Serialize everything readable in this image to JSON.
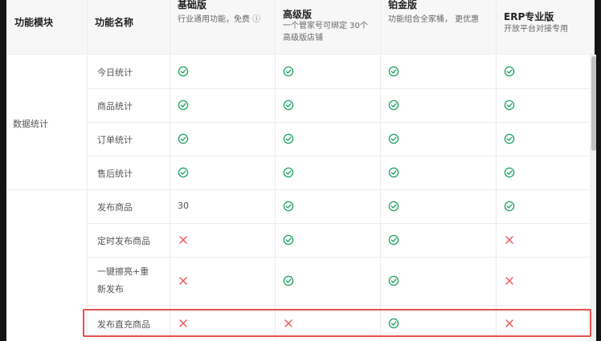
{
  "table": {
    "headers": {
      "module": "功能模块",
      "name": "功能名称",
      "basic": {
        "title": "基础版",
        "desc": [
          "行业通用功能，免费 ⓘ"
        ]
      },
      "advanced": {
        "title": "高级版",
        "desc": [
          "一个管家号可绑定 30个",
          "高级版店铺"
        ]
      },
      "platinum": {
        "title": "铂金版",
        "desc": [
          "功能组合全家桶， 更优惠"
        ]
      },
      "erp": {
        "title": "ERP专业版",
        "desc": [
          "开放平台对接专用"
        ]
      }
    },
    "groups": [
      {
        "label": "数据统计"
      },
      {
        "label": ""
      }
    ],
    "rows": [
      {
        "feature": [
          "今日统计"
        ],
        "basic": "check",
        "advanced": "check",
        "platinum": "check",
        "erp": "check"
      },
      {
        "feature": [
          "商品统计"
        ],
        "basic": "check",
        "advanced": "check",
        "platinum": "check",
        "erp": "check"
      },
      {
        "feature": [
          "订单统计"
        ],
        "basic": "check",
        "advanced": "check",
        "platinum": "check",
        "erp": "check"
      },
      {
        "feature": [
          "售后统计"
        ],
        "basic": "check",
        "advanced": "check",
        "platinum": "check",
        "erp": "check"
      },
      {
        "feature": [
          "发布商品"
        ],
        "basic": "30",
        "advanced": "check",
        "platinum": "check",
        "erp": "check"
      },
      {
        "feature": [
          "定时发布商品"
        ],
        "basic": "cross",
        "advanced": "check",
        "platinum": "check",
        "erp": "cross"
      },
      {
        "feature": [
          "一键擦亮+重",
          "新发布"
        ],
        "basic": "cross",
        "advanced": "check",
        "platinum": "check",
        "erp": "cross"
      },
      {
        "feature": [
          "发布直充商品"
        ],
        "basic": "cross",
        "advanced": "cross",
        "platinum": "check",
        "erp": "cross"
      }
    ]
  },
  "icons": {
    "check": "check-circle-icon",
    "cross": "cross-icon",
    "info": "info-icon"
  },
  "colors": {
    "check": "#1aa25f",
    "cross": "#f25353",
    "highlight": "#e65050",
    "header_bg": "#f7f7f7"
  }
}
